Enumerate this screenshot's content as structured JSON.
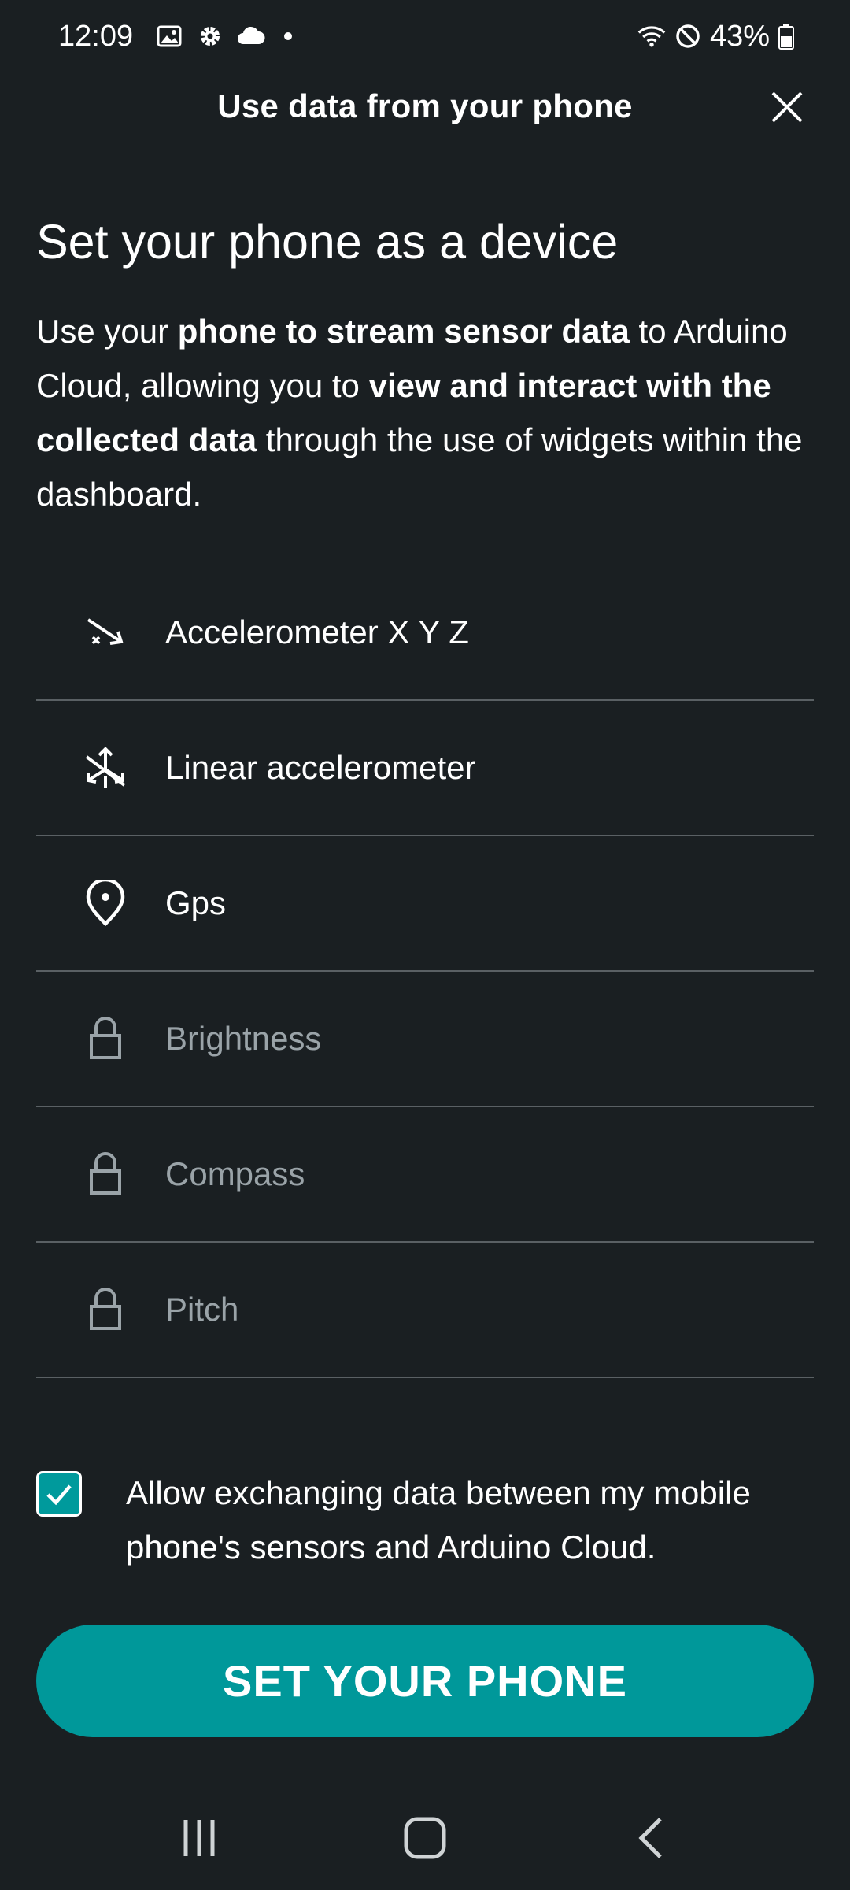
{
  "status_bar": {
    "time": "12:09",
    "battery": "43%",
    "left_icons": [
      "image-icon",
      "gear-icon",
      "cloud-icon",
      "dot-icon"
    ],
    "right_icons": [
      "wifi-icon",
      "do-not-disturb-icon",
      "battery-icon"
    ]
  },
  "header": {
    "title": "Use data from your phone",
    "close_icon": "close-icon"
  },
  "main": {
    "title": "Set your phone as a device",
    "intro": {
      "p1": "Use your ",
      "b1": "phone to stream sensor data",
      "p2": " to Arduino Cloud, allowing you to ",
      "b2": "view and interact with the collected data",
      "p3": " through the use of widgets within the dashboard."
    },
    "sensors": [
      {
        "label": "Accelerometer X Y Z",
        "icon": "accelerometer-icon",
        "locked": false
      },
      {
        "label": "Linear accelerometer",
        "icon": "linear-accelerometer-icon",
        "locked": false
      },
      {
        "label": "Gps",
        "icon": "location-pin-icon",
        "locked": false
      },
      {
        "label": "Brightness",
        "icon": "lock-icon",
        "locked": true
      },
      {
        "label": "Compass",
        "icon": "lock-icon",
        "locked": true
      },
      {
        "label": "Pitch",
        "icon": "lock-icon",
        "locked": true
      }
    ],
    "consent": {
      "checked": true,
      "text": "Allow exchanging data between my mobile phone's sensors and Arduino Cloud."
    },
    "cta_label": "SET YOUR PHONE"
  },
  "nav_bar": {
    "items": [
      "recent-apps-icon",
      "home-icon",
      "back-icon"
    ]
  },
  "colors": {
    "background": "#1a1f22",
    "accent": "#00989a",
    "divider": "#5a6064",
    "locked_text": "#9aa3a8"
  }
}
